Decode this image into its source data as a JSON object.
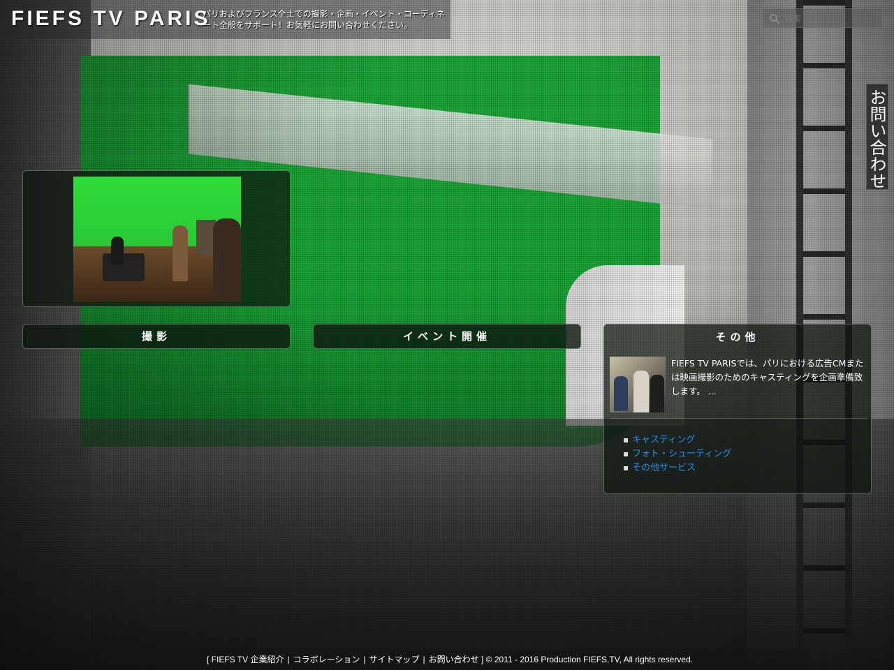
{
  "header": {
    "logo": "FIEFS TV PARIS",
    "tagline": "パリおよびフランス全土での撮影・企画・イベント・コーディネート全般をサポート！お気軽にお問い合わせください。"
  },
  "search": {
    "placeholder": "検索",
    "icon": "search-icon"
  },
  "contact_tab": {
    "label": "お問い合わせ"
  },
  "tabs": {
    "shoot": "撮影",
    "event": "イベント開催"
  },
  "other": {
    "title": "その他",
    "text": "FIEFS TV PARISでは、パリにおける広告CMまたは映画撮影のためのキャスティングを企画準備致します。 ...",
    "links": [
      "キャスティング",
      "フォト・シューティング",
      "その他サービス"
    ]
  },
  "footer": {
    "open": "[",
    "links": [
      "FIEFS TV 企業紹介",
      "コラボレーション",
      "サイトマップ",
      "お問い合わせ"
    ],
    "close": "]",
    "copyright": "© 2011 - 2016 Production FIEFS.TV, All rights reserved."
  }
}
